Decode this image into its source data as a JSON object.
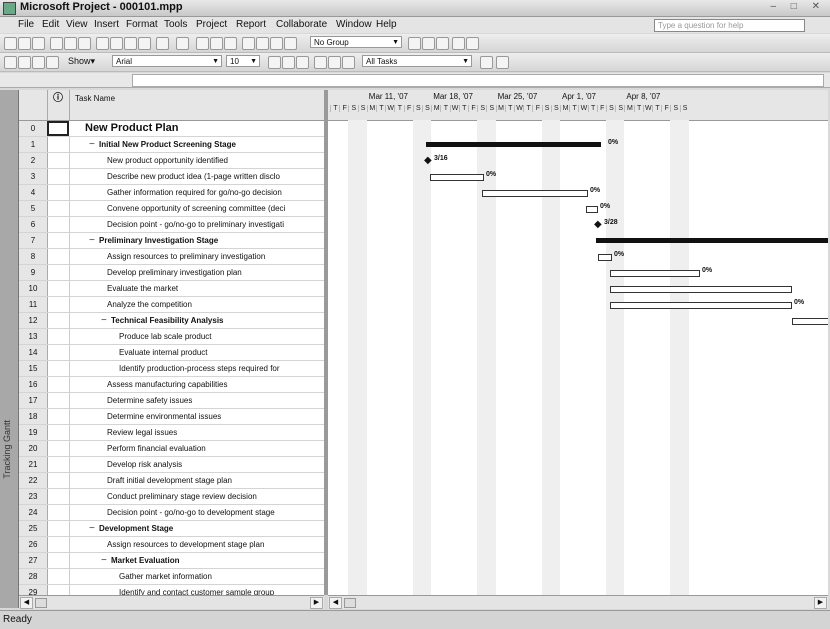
{
  "window": {
    "title": "Microsoft Project - 000101.mpp",
    "controls": "– □ ✕"
  },
  "menu": [
    "File",
    "Edit",
    "View",
    "Insert",
    "Format",
    "Tools",
    "Project",
    "Report",
    "Collaborate",
    "Window",
    "Help"
  ],
  "help_placeholder": "Type a question for help",
  "toolbar": {
    "group": "No Group",
    "font": "Arial",
    "size": "10",
    "show": "Show▾",
    "filter": "All Tasks"
  },
  "view_bar_label": "Tracking Gantt",
  "grid": {
    "headers": {
      "indicator": "ⓘ",
      "name": "Task Name"
    },
    "rows": [
      {
        "id": "0",
        "name": "New Product Plan",
        "indent": 0,
        "summary": true,
        "big": true
      },
      {
        "id": "1",
        "name": "Initial New Product Screening Stage",
        "indent": 1,
        "summary": true
      },
      {
        "id": "2",
        "name": "New product opportunity identified",
        "indent": 2
      },
      {
        "id": "3",
        "name": "Describe new product idea (1-page written disclo",
        "indent": 2
      },
      {
        "id": "4",
        "name": "Gather information required for go/no-go decision",
        "indent": 2
      },
      {
        "id": "5",
        "name": "Convene opportunity of screening committee (deci",
        "indent": 2
      },
      {
        "id": "6",
        "name": "Decision point - go/no-go to preliminary investigati",
        "indent": 2
      },
      {
        "id": "7",
        "name": "Preliminary Investigation Stage",
        "indent": 1,
        "summary": true
      },
      {
        "id": "8",
        "name": "Assign resources to preliminary investigation",
        "indent": 2
      },
      {
        "id": "9",
        "name": "Develop preliminary investigation plan",
        "indent": 2
      },
      {
        "id": "10",
        "name": "Evaluate the market",
        "indent": 2
      },
      {
        "id": "11",
        "name": "Analyze the competition",
        "indent": 2
      },
      {
        "id": "12",
        "name": "Technical Feasibility Analysis",
        "indent": 2,
        "summary": true
      },
      {
        "id": "13",
        "name": "Produce lab scale product",
        "indent": 3
      },
      {
        "id": "14",
        "name": "Evaluate internal product",
        "indent": 3
      },
      {
        "id": "15",
        "name": "Identify production-process steps required for",
        "indent": 3
      },
      {
        "id": "16",
        "name": "Assess manufacturing capabilities",
        "indent": 2
      },
      {
        "id": "17",
        "name": "Determine safety issues",
        "indent": 2
      },
      {
        "id": "18",
        "name": "Determine environmental issues",
        "indent": 2
      },
      {
        "id": "19",
        "name": "Review legal issues",
        "indent": 2
      },
      {
        "id": "20",
        "name": "Perform financial evaluation",
        "indent": 2
      },
      {
        "id": "21",
        "name": "Develop risk analysis",
        "indent": 2
      },
      {
        "id": "22",
        "name": "Draft initial development stage plan",
        "indent": 2
      },
      {
        "id": "23",
        "name": "Conduct preliminary stage review decision",
        "indent": 2
      },
      {
        "id": "24",
        "name": "Decision point - go/no-go to development stage",
        "indent": 2
      },
      {
        "id": "25",
        "name": "Development Stage",
        "indent": 1,
        "summary": true
      },
      {
        "id": "26",
        "name": "Assign resources to development stage plan",
        "indent": 2
      },
      {
        "id": "27",
        "name": "Market Evaluation",
        "indent": 2,
        "summary": true
      },
      {
        "id": "28",
        "name": "Gather market information",
        "indent": 3
      },
      {
        "id": "29",
        "name": "Identify and contact customer sample group",
        "indent": 3
      }
    ]
  },
  "gantt": {
    "weeks": [
      "Mar 11, '07",
      "Mar 18, '07",
      "Mar 25, '07",
      "Apr 1, '07",
      "Apr 8, '07"
    ],
    "day_letters": [
      "T",
      "F",
      "S",
      "S",
      "M",
      "T",
      "W",
      "T",
      "F",
      "S",
      "S",
      "M",
      "T",
      "W",
      "T",
      "F",
      "S",
      "S",
      "M",
      "T",
      "W",
      "T",
      "F",
      "S",
      "S",
      "M",
      "T",
      "W",
      "T",
      "F",
      "S",
      "S",
      "M",
      "T",
      "W",
      "T",
      "F",
      "S",
      "S"
    ],
    "labels": {
      "row1": "0%",
      "row2": "3/16",
      "row3": "0%",
      "row4": "0%",
      "row5": "0%",
      "row6": "3/28",
      "row8": "0%",
      "row9": "0%",
      "row11": "0%"
    }
  },
  "status": "Ready"
}
